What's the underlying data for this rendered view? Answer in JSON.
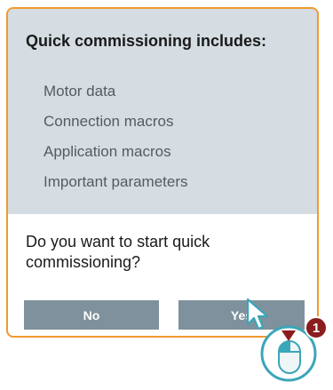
{
  "dialog": {
    "title": "Quick commissioning includes:",
    "items": [
      "Motor data",
      "Connection macros",
      "Application macros",
      "Important parameters"
    ],
    "question": "Do you want to start quick commissioning?",
    "buttons": {
      "no": "No",
      "yes": "Yes"
    }
  },
  "annotation": {
    "step_number": "1",
    "icon": "mouse-left-click-icon"
  },
  "colors": {
    "accent_border": "#f09a2c",
    "panel_background": "#d5dde2",
    "button_background": "#7f919c",
    "badge": "#8a1d1d",
    "mouse_outline": "#3aa6b9"
  }
}
